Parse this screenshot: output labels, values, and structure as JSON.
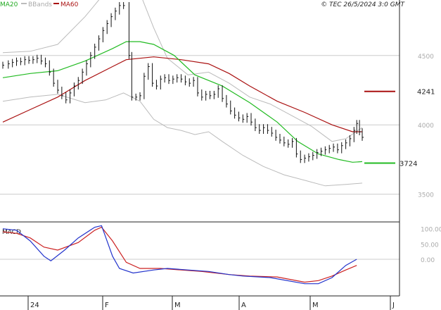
{
  "legend": {
    "ma20": "MA20",
    "bbands": "BBands",
    "ma60": "MA60",
    "copyright": "© TEC 26/5/2024 3:0 GMT",
    "macd": "MACD"
  },
  "colors": {
    "ma20": "#22bb22",
    "bbands": "#bbbbbb",
    "ma60": "#aa1111",
    "price": "#111111",
    "macd": "#2233cc",
    "signal": "#cc2222",
    "grid": "#cccccc"
  },
  "chart_data": [
    {
      "type": "line",
      "name": "price",
      "ylim": [
        3300,
        4900
      ],
      "y_ticks": [
        3500,
        4000,
        4500
      ],
      "x_ticks": [
        "24",
        "F",
        "M",
        "A",
        "M",
        "J"
      ],
      "markers": [
        {
          "label": "4241",
          "value": 4241,
          "color": "#aa1111"
        },
        {
          "label": "3724",
          "value": 3724,
          "color": "#22bb22"
        }
      ],
      "price": [
        [
          0,
          4430
        ],
        [
          4,
          4440
        ],
        [
          7,
          4450
        ],
        [
          10,
          4460
        ],
        [
          13,
          4455
        ],
        [
          16,
          4470
        ],
        [
          19,
          4465
        ],
        [
          22,
          4470
        ],
        [
          25,
          4480
        ],
        [
          28,
          4460
        ],
        [
          31,
          4440
        ],
        [
          34,
          4380
        ],
        [
          37,
          4300
        ],
        [
          40,
          4250
        ],
        [
          43,
          4210
        ],
        [
          46,
          4180
        ],
        [
          49,
          4230
        ],
        [
          52,
          4280
        ],
        [
          55,
          4320
        ],
        [
          58,
          4380
        ],
        [
          61,
          4440
        ],
        [
          64,
          4500
        ],
        [
          67,
          4560
        ],
        [
          70,
          4620
        ],
        [
          73,
          4680
        ],
        [
          76,
          4730
        ],
        [
          79,
          4780
        ],
        [
          82,
          4820
        ],
        [
          85,
          4860
        ],
        [
          88,
          4860
        ],
        [
          92,
          4500
        ],
        [
          94,
          4200
        ],
        [
          97,
          4200
        ],
        [
          100,
          4210
        ],
        [
          103,
          4350
        ],
        [
          106,
          4420
        ],
        [
          109,
          4300
        ],
        [
          112,
          4280
        ],
        [
          115,
          4330
        ],
        [
          118,
          4340
        ],
        [
          121,
          4320
        ],
        [
          124,
          4330
        ],
        [
          127,
          4340
        ],
        [
          130,
          4330
        ],
        [
          133,
          4310
        ],
        [
          136,
          4300
        ],
        [
          139,
          4320
        ],
        [
          142,
          4230
        ],
        [
          145,
          4200
        ],
        [
          148,
          4220
        ],
        [
          151,
          4210
        ],
        [
          154,
          4220
        ],
        [
          157,
          4260
        ],
        [
          160,
          4190
        ],
        [
          163,
          4150
        ],
        [
          166,
          4100
        ],
        [
          169,
          4070
        ],
        [
          172,
          4050
        ],
        [
          175,
          4040
        ],
        [
          178,
          4060
        ],
        [
          181,
          4020
        ],
        [
          184,
          3980
        ],
        [
          187,
          3960
        ],
        [
          190,
          3980
        ],
        [
          193,
          3960
        ],
        [
          196,
          3940
        ],
        [
          199,
          3910
        ],
        [
          202,
          3890
        ],
        [
          205,
          3870
        ],
        [
          208,
          3860
        ],
        [
          211,
          3880
        ],
        [
          214,
          3790
        ],
        [
          217,
          3750
        ],
        [
          220,
          3760
        ],
        [
          223,
          3770
        ],
        [
          226,
          3780
        ],
        [
          229,
          3800
        ],
        [
          232,
          3810
        ],
        [
          235,
          3820
        ],
        [
          238,
          3830
        ],
        [
          241,
          3840
        ],
        [
          244,
          3820
        ],
        [
          247,
          3850
        ],
        [
          250,
          3870
        ],
        [
          253,
          3900
        ],
        [
          256,
          3960
        ],
        [
          258,
          4010
        ],
        [
          260,
          3950
        ],
        [
          262,
          3910
        ]
      ],
      "ma20": [
        [
          0,
          4340
        ],
        [
          20,
          4370
        ],
        [
          40,
          4390
        ],
        [
          60,
          4460
        ],
        [
          80,
          4550
        ],
        [
          90,
          4600
        ],
        [
          100,
          4600
        ],
        [
          110,
          4580
        ],
        [
          125,
          4500
        ],
        [
          140,
          4360
        ],
        [
          160,
          4280
        ],
        [
          180,
          4160
        ],
        [
          200,
          4020
        ],
        [
          215,
          3880
        ],
        [
          230,
          3790
        ],
        [
          245,
          3750
        ],
        [
          255,
          3730
        ],
        [
          262,
          3735
        ]
      ],
      "ma60": [
        [
          0,
          4020
        ],
        [
          20,
          4110
        ],
        [
          40,
          4200
        ],
        [
          60,
          4320
        ],
        [
          80,
          4420
        ],
        [
          90,
          4470
        ],
        [
          110,
          4490
        ],
        [
          130,
          4470
        ],
        [
          150,
          4440
        ],
        [
          165,
          4370
        ],
        [
          180,
          4280
        ],
        [
          200,
          4170
        ],
        [
          220,
          4090
        ],
        [
          240,
          4000
        ],
        [
          255,
          3950
        ],
        [
          262,
          3950
        ]
      ],
      "bb_upper": [
        [
          0,
          4520
        ],
        [
          20,
          4530
        ],
        [
          40,
          4580
        ],
        [
          60,
          4780
        ],
        [
          75,
          4960
        ],
        [
          88,
          5040
        ],
        [
          100,
          4950
        ],
        [
          110,
          4700
        ],
        [
          120,
          4480
        ],
        [
          135,
          4360
        ],
        [
          150,
          4380
        ],
        [
          165,
          4300
        ],
        [
          180,
          4200
        ],
        [
          195,
          4150
        ],
        [
          210,
          4070
        ],
        [
          225,
          3990
        ],
        [
          240,
          3880
        ],
        [
          250,
          3900
        ],
        [
          262,
          3980
        ]
      ],
      "bb_lower": [
        [
          0,
          4170
        ],
        [
          20,
          4200
        ],
        [
          40,
          4220
        ],
        [
          60,
          4160
        ],
        [
          75,
          4180
        ],
        [
          88,
          4230
        ],
        [
          100,
          4170
        ],
        [
          110,
          4040
        ],
        [
          120,
          3980
        ],
        [
          130,
          3960
        ],
        [
          140,
          3930
        ],
        [
          150,
          3950
        ],
        [
          160,
          3880
        ],
        [
          175,
          3780
        ],
        [
          190,
          3700
        ],
        [
          205,
          3640
        ],
        [
          220,
          3600
        ],
        [
          235,
          3560
        ],
        [
          250,
          3570
        ],
        [
          262,
          3580
        ]
      ]
    },
    {
      "type": "line",
      "name": "macd",
      "ylim": [
        -120,
        120
      ],
      "y_ticks": [
        0,
        50,
        100
      ],
      "macd": [
        [
          0,
          100
        ],
        [
          10,
          95
        ],
        [
          20,
          60
        ],
        [
          30,
          10
        ],
        [
          35,
          -5
        ],
        [
          45,
          30
        ],
        [
          55,
          70
        ],
        [
          67,
          105
        ],
        [
          72,
          110
        ],
        [
          80,
          10
        ],
        [
          85,
          -30
        ],
        [
          95,
          -45
        ],
        [
          110,
          -35
        ],
        [
          120,
          -30
        ],
        [
          135,
          -35
        ],
        [
          150,
          -40
        ],
        [
          165,
          -50
        ],
        [
          175,
          -55
        ],
        [
          195,
          -60
        ],
        [
          220,
          -80
        ],
        [
          230,
          -80
        ],
        [
          240,
          -60
        ],
        [
          250,
          -20
        ],
        [
          258,
          0
        ]
      ],
      "signal": [
        [
          0,
          90
        ],
        [
          10,
          85
        ],
        [
          20,
          70
        ],
        [
          30,
          40
        ],
        [
          40,
          30
        ],
        [
          55,
          55
        ],
        [
          67,
          95
        ],
        [
          72,
          105
        ],
        [
          80,
          60
        ],
        [
          90,
          -10
        ],
        [
          100,
          -30
        ],
        [
          115,
          -30
        ],
        [
          130,
          -35
        ],
        [
          145,
          -40
        ],
        [
          165,
          -50
        ],
        [
          180,
          -55
        ],
        [
          200,
          -58
        ],
        [
          220,
          -75
        ],
        [
          230,
          -70
        ],
        [
          240,
          -55
        ],
        [
          250,
          -35
        ],
        [
          258,
          -20
        ]
      ]
    }
  ]
}
